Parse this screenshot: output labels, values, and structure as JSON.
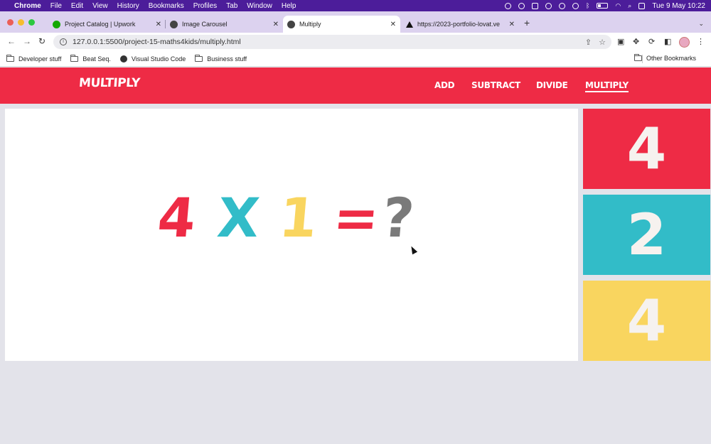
{
  "menubar": {
    "items": [
      "Chrome",
      "File",
      "Edit",
      "View",
      "History",
      "Bookmarks",
      "Profiles",
      "Tab",
      "Window",
      "Help"
    ],
    "datetime": "Tue 9 May  10:22"
  },
  "tabs": [
    {
      "title": "Project Catalog | Upwork",
      "favicon_color": "#14a800"
    },
    {
      "title": "Image Carousel",
      "favicon_color": "#333333"
    },
    {
      "title": "Multiply",
      "favicon_color": "#333333"
    },
    {
      "title": "https://2023-portfolio-lovat.ve",
      "favicon_color": "#111111"
    }
  ],
  "address_bar": {
    "url": "127.0.0.1:5500/project-15-maths4kids/multiply.html"
  },
  "bookmarks": {
    "items": [
      "Developer stuff",
      "Beat Seq.",
      "Visual Studio Code",
      "Business stuff"
    ],
    "other": "Other Bookmarks"
  },
  "site": {
    "logo": "MULTIPLY",
    "nav": [
      "ADD",
      "SUBTRACT",
      "DIVIDE",
      "MULTIPLY"
    ],
    "active_nav": "MULTIPLY"
  },
  "equation": {
    "operand1": "4",
    "operator": "X",
    "operand2": "1",
    "equals": "=",
    "answer": "?"
  },
  "answer_options": [
    "4",
    "2",
    "4"
  ],
  "colors": {
    "red": "#ee2b45",
    "teal": "#32bcc8",
    "yellow": "#f9d55f",
    "grey": "#7a7a7a"
  }
}
